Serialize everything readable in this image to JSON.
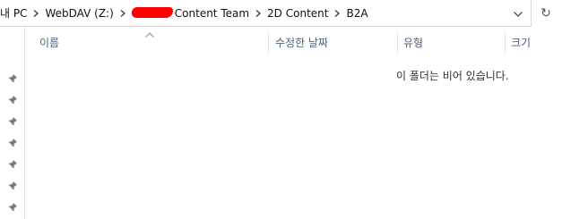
{
  "address_bar": {
    "breadcrumbs": [
      {
        "label": "내 PC"
      },
      {
        "label": "WebDAV (Z:)"
      },
      {
        "label": "Content Team",
        "redacted_prefix": true
      },
      {
        "label": "2D Content"
      },
      {
        "label": "B2A"
      }
    ],
    "dropdown_icon": "chevron-down-icon",
    "refresh_icon": "refresh-icon",
    "refresh_glyph": "↻"
  },
  "columns": {
    "name": "이름",
    "modified": "수정한 날짜",
    "type": "유형",
    "size": "크기",
    "sort_indicator": "ascending"
  },
  "nav_pane": {
    "pinned_count": 7,
    "pin_icon": "pin-icon"
  },
  "empty_message": "이 폴더는 비어 있습니다.",
  "colors": {
    "header_text": "#4c607a",
    "redaction": "#ff0000",
    "divider": "#e5e5e5"
  }
}
